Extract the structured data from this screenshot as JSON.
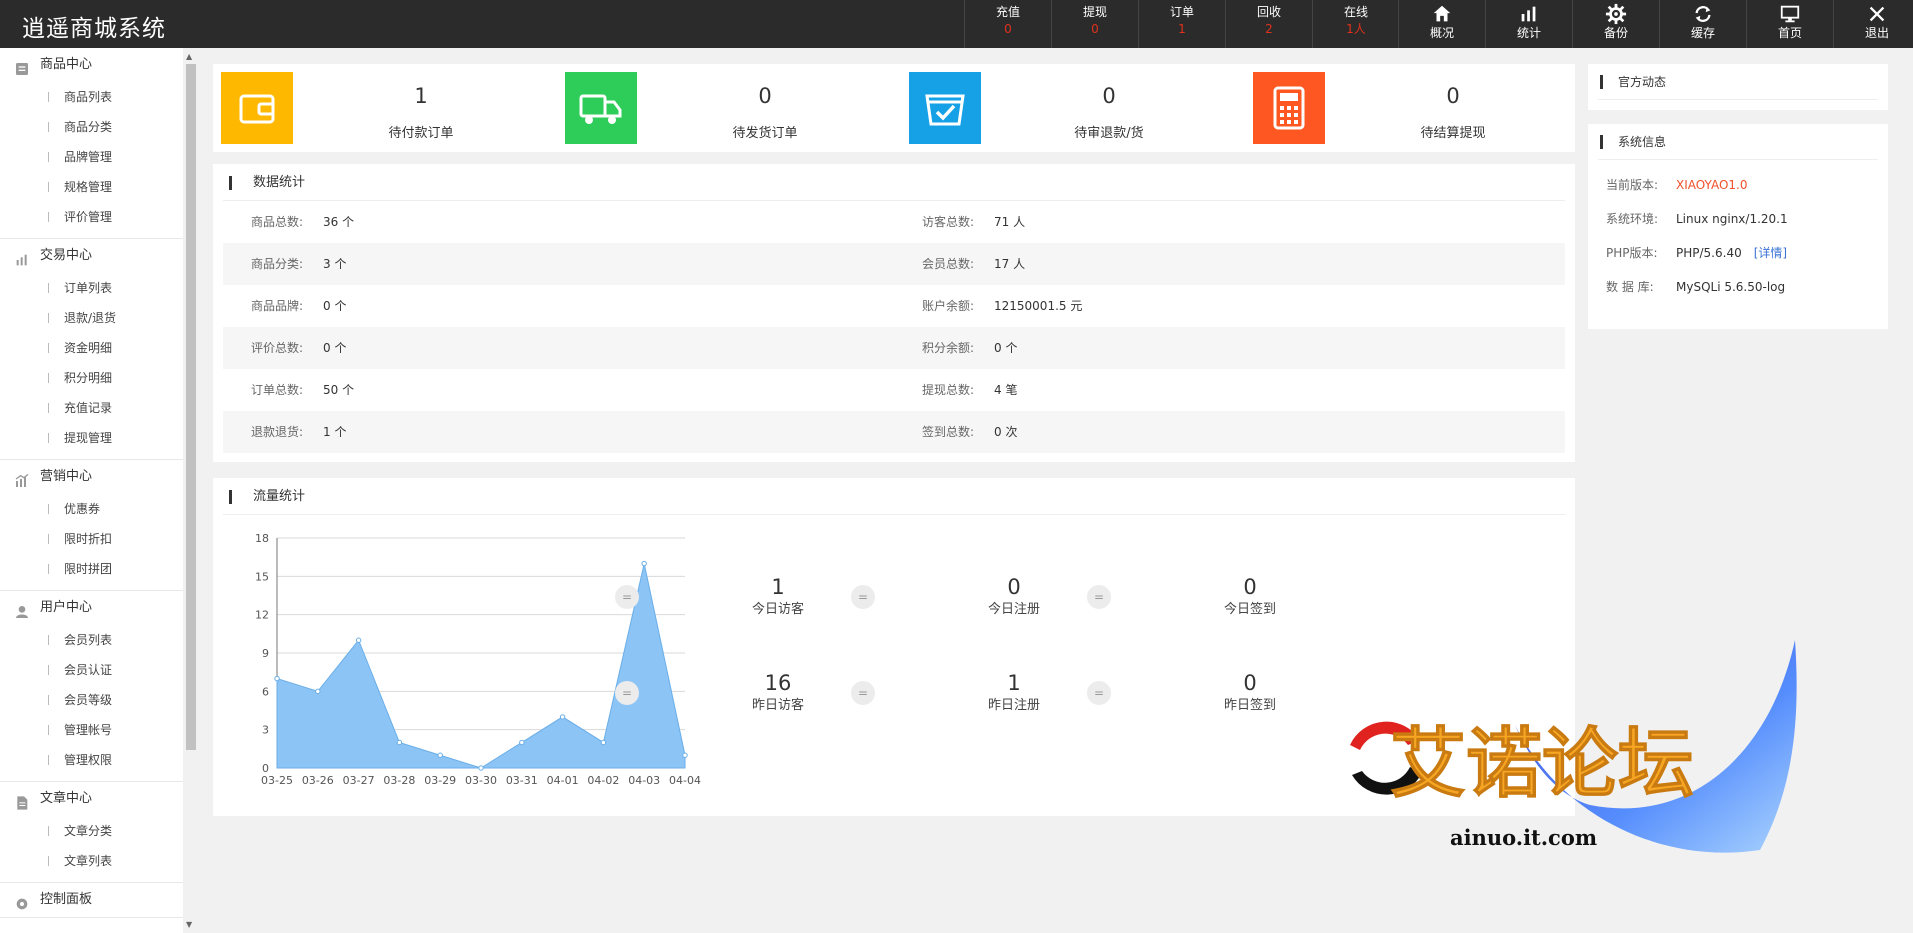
{
  "app": {
    "title": "逍遥商城系统"
  },
  "topbar": {
    "stats": [
      {
        "label": "充值",
        "value": "0"
      },
      {
        "label": "提现",
        "value": "0"
      },
      {
        "label": "订单",
        "value": "1"
      },
      {
        "label": "回收",
        "value": "2"
      },
      {
        "label": "在线",
        "value": "1人"
      }
    ],
    "nav": [
      {
        "label": "概况",
        "icon": "home-icon"
      },
      {
        "label": "统计",
        "icon": "bar-chart-icon"
      },
      {
        "label": "备份",
        "icon": "gear-icon"
      },
      {
        "label": "缓存",
        "icon": "refresh-icon"
      },
      {
        "label": "首页",
        "icon": "monitor-icon"
      },
      {
        "label": "退出",
        "icon": "close-icon"
      }
    ]
  },
  "sidebar": {
    "groups": [
      {
        "title": "商品中心",
        "icon": "goods-icon",
        "items": [
          "商品列表",
          "商品分类",
          "品牌管理",
          "规格管理",
          "评价管理"
        ]
      },
      {
        "title": "交易中心",
        "icon": "bar-chart-icon",
        "items": [
          "订单列表",
          "退款/退货",
          "资金明细",
          "积分明细",
          "充值记录",
          "提现管理"
        ]
      },
      {
        "title": "营销中心",
        "icon": "marketing-icon",
        "items": [
          "优惠券",
          "限时折扣",
          "限时拼团"
        ]
      },
      {
        "title": "用户中心",
        "icon": "user-icon",
        "items": [
          "会员列表",
          "会员认证",
          "会员等级",
          "管理帐号",
          "管理权限"
        ]
      },
      {
        "title": "文章中心",
        "icon": "article-icon",
        "items": [
          "文章分类",
          "文章列表"
        ]
      },
      {
        "title": "控制面板",
        "icon": "settings-icon",
        "items": []
      }
    ]
  },
  "kpis": [
    {
      "value": "1",
      "label": "待付款订单",
      "color": "#ffb800",
      "icon": "wallet-icon"
    },
    {
      "value": "0",
      "label": "待发货订单",
      "color": "#2ecc59",
      "icon": "truck-icon"
    },
    {
      "value": "0",
      "label": "待审退款/货",
      "color": "#16a0e6",
      "icon": "box-check-icon"
    },
    {
      "value": "0",
      "label": "待结算提现",
      "color": "#ff5722",
      "icon": "calculator-icon"
    }
  ],
  "data_stats": {
    "title": "数据统计",
    "rows": [
      [
        {
          "k": "商品总数:",
          "v": "36 个"
        },
        {
          "k": "访客总数:",
          "v": "71 人"
        }
      ],
      [
        {
          "k": "商品分类:",
          "v": "3 个"
        },
        {
          "k": "会员总数:",
          "v": "17 人"
        }
      ],
      [
        {
          "k": "商品品牌:",
          "v": "0 个"
        },
        {
          "k": "账户余额:",
          "v": "12150001.5 元"
        }
      ],
      [
        {
          "k": "评价总数:",
          "v": "0 个"
        },
        {
          "k": "积分余额:",
          "v": "0 个"
        }
      ],
      [
        {
          "k": "订单总数:",
          "v": "50 个"
        },
        {
          "k": "提现总数:",
          "v": "4 笔"
        }
      ],
      [
        {
          "k": "退款退货:",
          "v": "1 个"
        },
        {
          "k": "签到总数:",
          "v": "0 次"
        }
      ]
    ]
  },
  "flow": {
    "title": "流量统计",
    "stats": [
      {
        "value": "1",
        "label": "今日访客"
      },
      {
        "value": "0",
        "label": "今日注册"
      },
      {
        "value": "0",
        "label": "今日签到"
      },
      {
        "value": "16",
        "label": "昨日访客"
      },
      {
        "value": "1",
        "label": "昨日注册"
      },
      {
        "value": "0",
        "label": "昨日签到"
      }
    ],
    "eq_symbol": "="
  },
  "chart_data": {
    "type": "area",
    "categories": [
      "03-25",
      "03-26",
      "03-27",
      "03-28",
      "03-29",
      "03-30",
      "03-31",
      "04-01",
      "04-02",
      "04-03",
      "04-04"
    ],
    "values": [
      7,
      6,
      10,
      2,
      1,
      0,
      2,
      4,
      2,
      16,
      1
    ],
    "yticks": [
      0,
      3,
      6,
      9,
      12,
      15,
      18
    ],
    "ylim": [
      0,
      18
    ],
    "color": "#8cc4f5",
    "line_color": "#6aaee8"
  },
  "news": {
    "title": "官方动态"
  },
  "sysinfo": {
    "title": "系统信息",
    "rows": [
      {
        "k": "当前版本:",
        "v": "XIAOYAO1.0",
        "highlight": true
      },
      {
        "k": "系统环境:",
        "v": "Linux nginx/1.20.1"
      },
      {
        "k": "PHP版本:",
        "v": "PHP/5.6.40",
        "link": "[详情]"
      },
      {
        "k": "数  据 库:",
        "v": "MySQLi 5.6.50-log"
      }
    ]
  },
  "watermark": {
    "text": "艾诺论坛",
    "url": "ainuo.it.com"
  }
}
